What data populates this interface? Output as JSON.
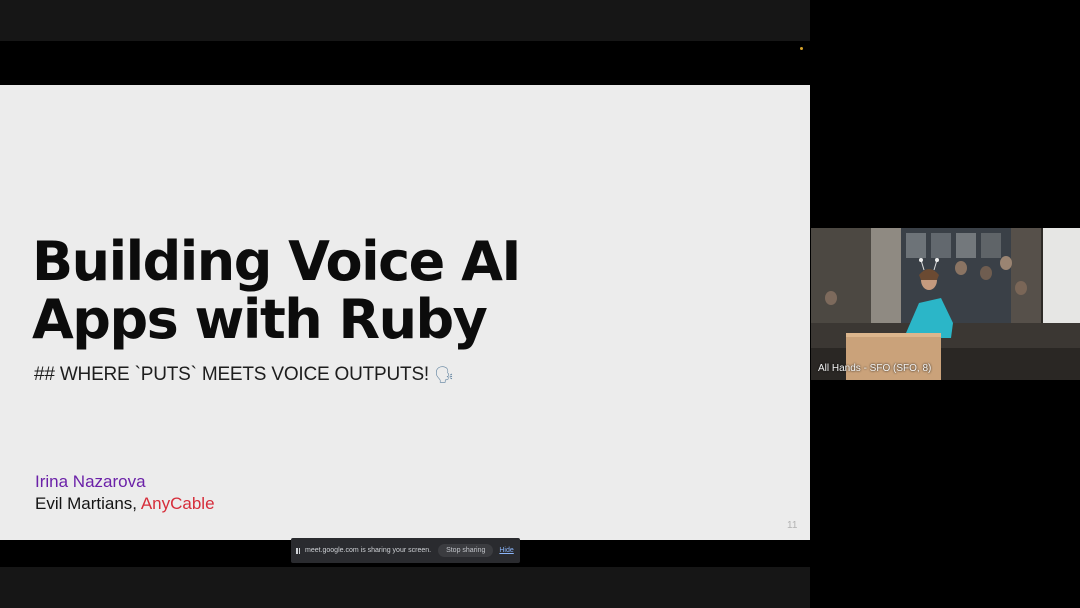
{
  "slide": {
    "title_line1": "Building Voice AI",
    "title_line2": "Apps with Ruby",
    "subtitle": "## WHERE `PUTS` MEETS VOICE OUTPUTS!",
    "subtitle_icon": "speaking-head-icon",
    "author": "Irina Nazarova",
    "affiliation_prefix": "Evil Martians, ",
    "affiliation_link": "AnyCable",
    "page_number": "11",
    "colors": {
      "author": "#6b21a8",
      "anycable": "#d62d3a",
      "background": "#ececec"
    }
  },
  "share_bar": {
    "message": "meet.google.com is sharing your screen.",
    "stop_label": "Stop sharing",
    "hide_label": "Hide"
  },
  "participant": {
    "label": "All Hands - SFO (SFO, 8)"
  }
}
